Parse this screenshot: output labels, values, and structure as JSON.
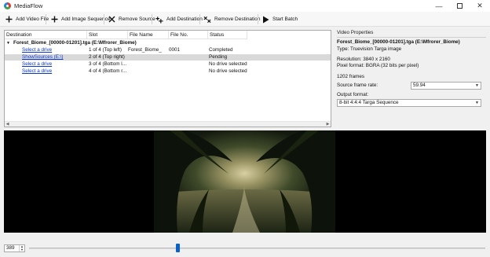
{
  "window": {
    "title": "MediaFlow"
  },
  "toolbar": {
    "add_video_file": "Add Video File",
    "add_image_sequence": "Add Image Sequence",
    "remove_source": "Remove Source",
    "add_destination": "Add Destination",
    "remove_destination": "Remove Destination",
    "start_batch": "Start Batch"
  },
  "table": {
    "columns": [
      "Destination",
      "Slot",
      "File Name",
      "File No.",
      "Status"
    ],
    "group_label": "Forest_Biome_[00000-01201].tga (E:\\Mfrorer_Biome)",
    "rows": [
      {
        "destination": "Select a drive",
        "slot": "1 of 4 (Top left)",
        "file_name": "Forest_Biome_",
        "file_no": "0001",
        "status": "Completed"
      },
      {
        "destination": "ShowSources (E:\\)",
        "slot": "2 of 4 (Top right)",
        "file_name": "",
        "file_no": "",
        "status": "Pending"
      },
      {
        "destination": "Select a drive",
        "slot": "3 of 4 (Bottom l...",
        "file_name": "",
        "file_no": "",
        "status": "No drive selected"
      },
      {
        "destination": "Select a drive",
        "slot": "4 of 4 (Bottom r...",
        "file_name": "",
        "file_no": "",
        "status": "No drive selected"
      }
    ]
  },
  "properties": {
    "section_title": "Video Properties",
    "file_title": "Forest_Biome_[00000-01201].tga (E:\\Mfrorer_Biome)",
    "type": "Type: Truevision Targa image",
    "resolution": "Resolution: 3840 x 2160",
    "pixel_format": "Pixel format: BGRA (32 bits per pixel)",
    "frames": "1202 frames",
    "source_frame_rate_label": "Source frame rate:",
    "source_frame_rate_value": "59.94",
    "output_format_label": "Output format:",
    "output_format_value": "8-bit 4:4:4 Targa Sequence"
  },
  "playback": {
    "current_frame": "389",
    "total_frames": 1202,
    "position_fraction": 0.324
  },
  "colors": {
    "link": "#0b36d3",
    "selected_row": "#d9d9d9",
    "slider_thumb": "#0a62c9",
    "video_background": "#000000"
  },
  "icons": {
    "app": "mediaflow-logo-icon",
    "add_video_file": "plus-icon",
    "add_image_sequence": "plus-icon",
    "remove_source": "x-icon",
    "add_destination": "add-multiple-icon",
    "remove_destination": "remove-multiple-icon",
    "start_batch": "play-icon"
  }
}
